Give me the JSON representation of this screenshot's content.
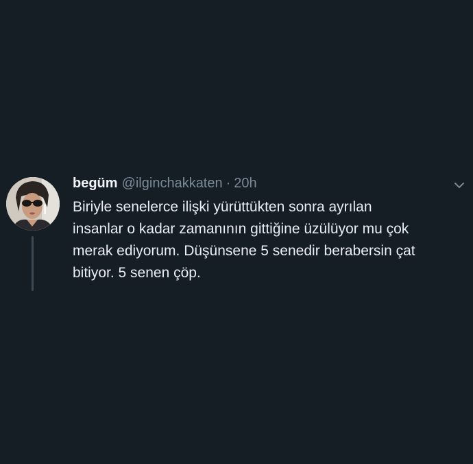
{
  "tweet": {
    "display_name": "begüm",
    "handle": "@ilginchakkaten",
    "separator": "·",
    "time": "20h",
    "text": "Biriyle senelerce ilişki yürüttükten sonra ayrılan\ninsanlar o kadar zamanının gittiğine üzülüyor mu çok\nmerak ediyorum. Düşünsene 5 senedir berabersin çat\nbitiyor. 5 senen çöp."
  },
  "icons": {
    "menu": "chevron-down-icon"
  },
  "colors": {
    "background": "#151d25",
    "text": "#e9eef2",
    "muted": "#7b8a98",
    "thread_line": "#3c4a56"
  }
}
